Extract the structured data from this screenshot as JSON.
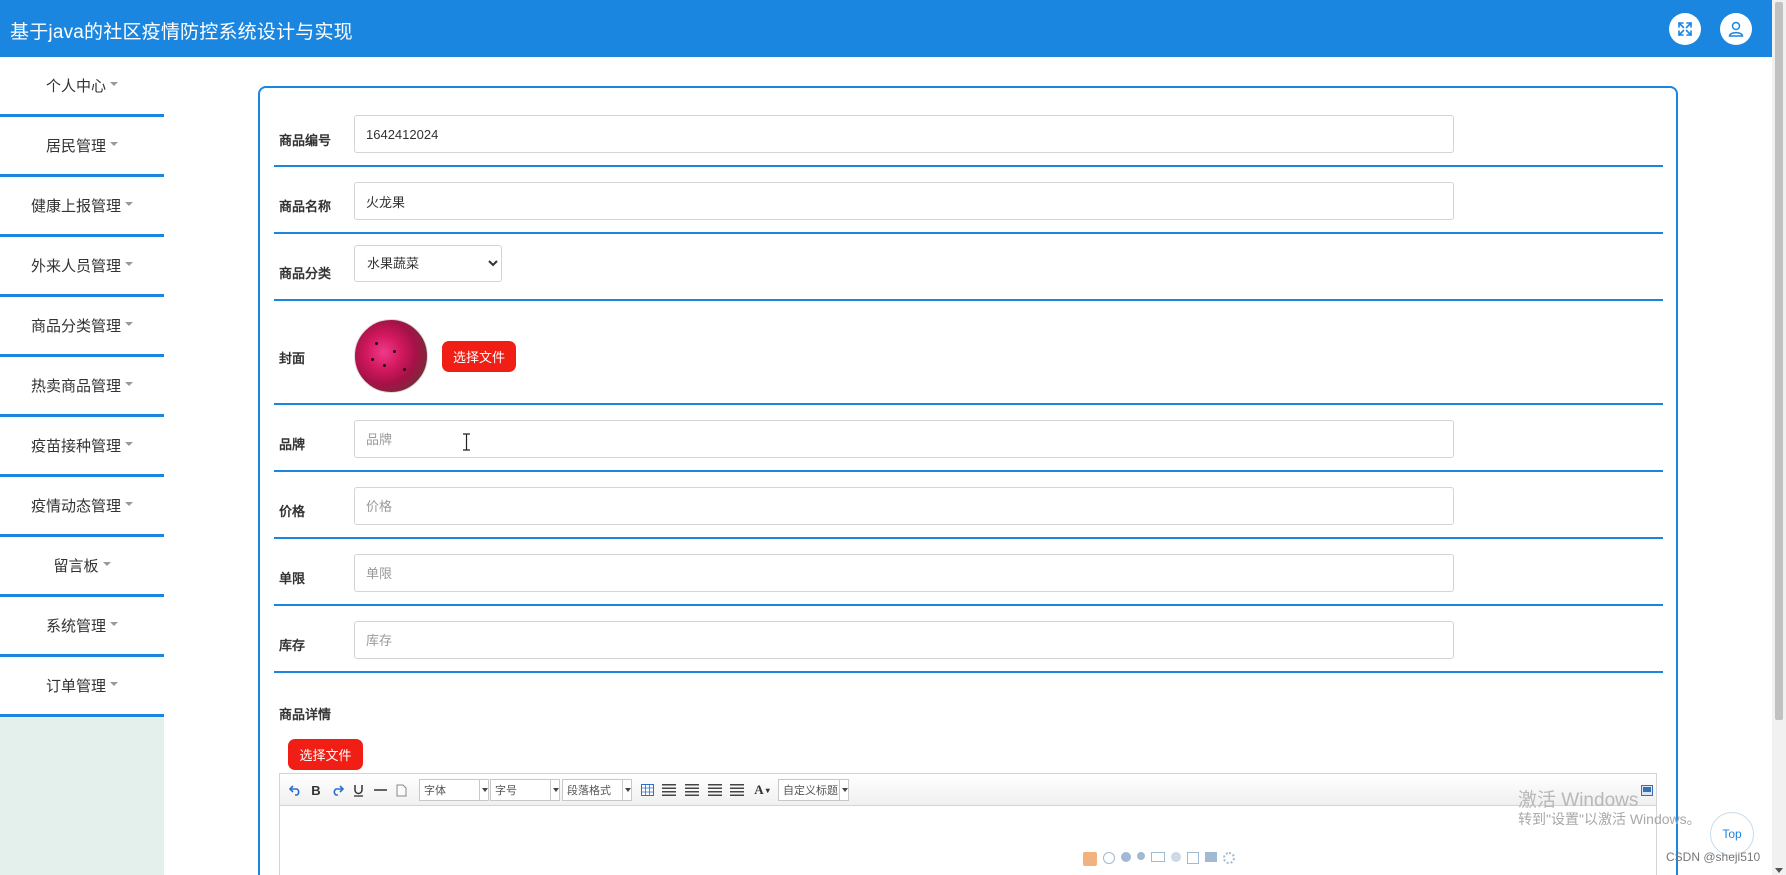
{
  "app": {
    "title": "基于java的社区疫情防控系统设计与实现"
  },
  "header": {
    "fullscreen_icon": "expand-icon",
    "user_icon": "user-icon"
  },
  "sidebar": {
    "items": [
      {
        "label": "个人中心"
      },
      {
        "label": "居民管理"
      },
      {
        "label": "健康上报管理"
      },
      {
        "label": "外来人员管理"
      },
      {
        "label": "商品分类管理"
      },
      {
        "label": "热卖商品管理"
      },
      {
        "label": "疫苗接种管理"
      },
      {
        "label": "疫情动态管理"
      },
      {
        "label": "留言板"
      },
      {
        "label": "系统管理"
      },
      {
        "label": "订单管理"
      }
    ]
  },
  "form": {
    "code": {
      "label": "商品编号",
      "value": "1642412024"
    },
    "name": {
      "label": "商品名称",
      "value": "火龙果"
    },
    "category": {
      "label": "商品分类",
      "value": "水果蔬菜"
    },
    "cover": {
      "label": "封面",
      "button": "选择文件"
    },
    "brand": {
      "label": "品牌",
      "placeholder": "品牌"
    },
    "price": {
      "label": "价格",
      "placeholder": "价格"
    },
    "limit": {
      "label": "单限",
      "placeholder": "单限"
    },
    "stock": {
      "label": "库存",
      "placeholder": "库存"
    },
    "detail": {
      "label": "商品详情",
      "button": "选择文件"
    }
  },
  "editor": {
    "bold": "B",
    "font_color": "A",
    "font_family": "字体",
    "font_size": "字号",
    "paragraph": "段落格式",
    "custom_title": "自定义标题"
  },
  "overlay": {
    "watermark_title": "激活 Windows",
    "watermark_sub": "转到\"设置\"以激活 Windows。",
    "top_button": "Top",
    "credit": "CSDN @sheji510"
  },
  "colors": {
    "primary": "#1a86e0",
    "danger": "#f01e14",
    "sidebar_bg": "#e4f0ec"
  }
}
